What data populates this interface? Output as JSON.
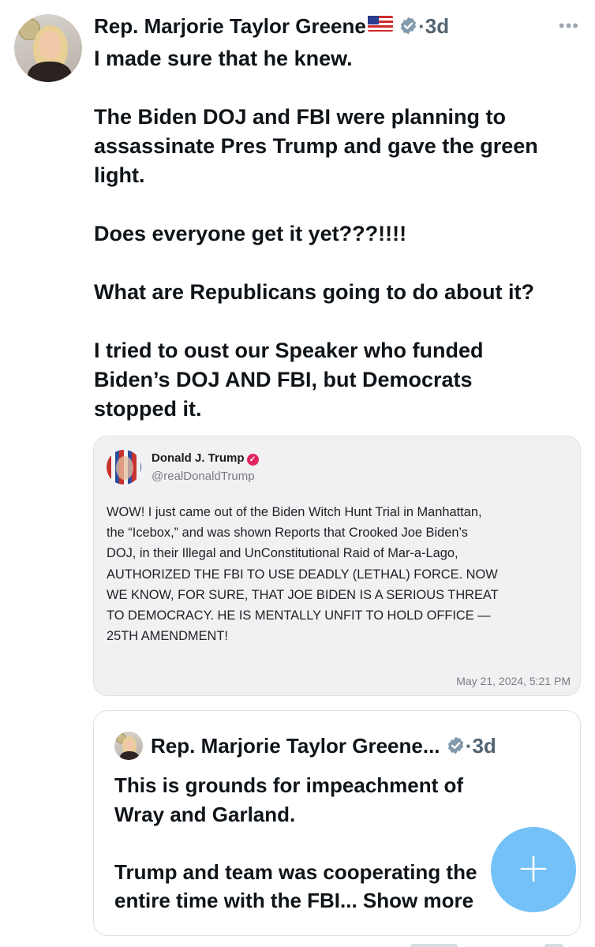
{
  "post": {
    "author_name": "Rep. Marjorie Taylor Greene",
    "flag_emoji": "🇺🇸",
    "separator": "·",
    "time_ago": "3d",
    "more_icon": "more-dots-icon",
    "text_lines": [
      "I made sure that he knew.",
      "",
      "The Biden DOJ and FBI were planning to",
      "assassinate Pres Trump and gave the green",
      "light.",
      "",
      "Does everyone get it yet???!!!!",
      "",
      "What are Republicans going to do about it?",
      "",
      "I tried to oust our Speaker who funded",
      "Biden’s DOJ AND FBI, but Democrats",
      "stopped it."
    ]
  },
  "quoted_post": {
    "author_name": "Donald J. Trump",
    "handle": "@realDonaldTrump",
    "body_lines": [
      "WOW! I just came out of the Biden Witch Hunt Trial in Manhattan,",
      "the “Icebox,” and was shown Reports that Crooked Joe Biden’s",
      "DOJ, in their Illegal and UnConstitutional Raid of Mar-a-Lago,",
      "AUTHORIZED THE FBI TO USE DEADLY (LETHAL) FORCE. NOW",
      "WE KNOW, FOR SURE, THAT JOE BIDEN IS A SERIOUS THREAT",
      "TO DEMOCRACY. HE IS MENTALLY UNFIT TO HOLD OFFICE —",
      "25TH AMENDMENT!"
    ],
    "timestamp": "May 21, 2024, 5:21 PM"
  },
  "embedded_post": {
    "author_name": "Rep. Marjorie Taylor Greene...",
    "separator": "·",
    "time_ago": "3d",
    "text_lines": [
      "This is grounds for impeachment of",
      "Wray and Garland.",
      "",
      "Trump and team was cooperating the",
      "entire time with the FBI... Show more"
    ]
  },
  "compose_button": {
    "icon": "plus-icon",
    "label": "+"
  },
  "colors": {
    "verified_badge": "#829aab",
    "quote_verified": "#e0245e",
    "compose": "#1d9bf0"
  }
}
